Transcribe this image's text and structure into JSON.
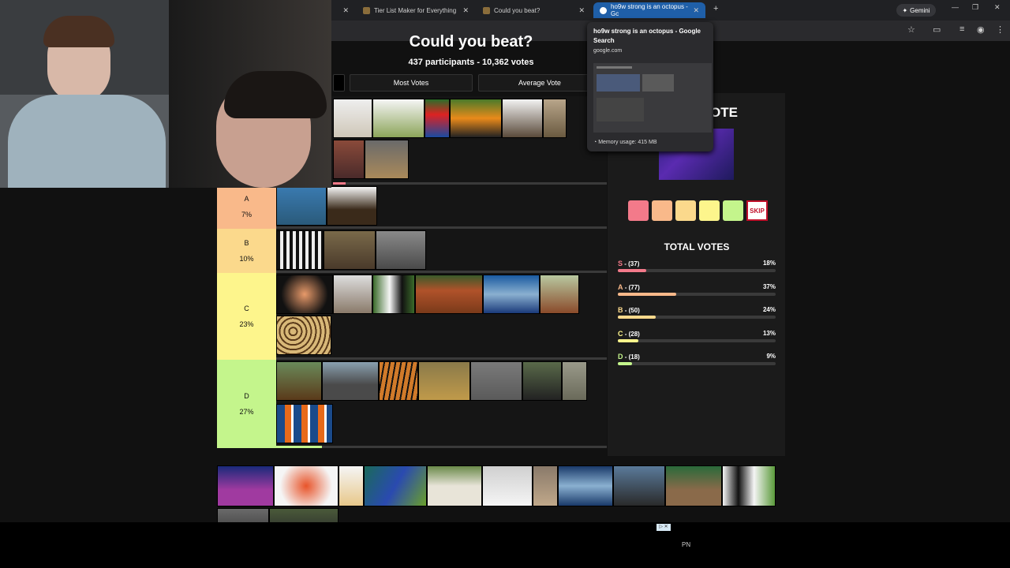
{
  "tabs": [
    {
      "title": "Tier List Maker for Everything",
      "active": false
    },
    {
      "title": "Could you beat?",
      "active": false
    },
    {
      "title": "ho9w strong is an octopus - Gc",
      "active": true
    }
  ],
  "toolbar": {
    "gemini_label": "Gemini"
  },
  "hover_card": {
    "title": "ho9w strong is an octopus - Google Search",
    "url": "google.com",
    "memory": "Memory usage: 415 MB"
  },
  "page": {
    "title": "Could you beat?",
    "subtitle": "437 participants - 10,362 votes",
    "toggle_most": "Most Votes",
    "toggle_average": "Average Vote"
  },
  "tiers": [
    {
      "letter": "A",
      "pct": "7%",
      "color": "#f9b98a"
    },
    {
      "letter": "B",
      "pct": "10%",
      "color": "#fbd98c"
    },
    {
      "letter": "C",
      "pct": "23%",
      "color": "#fdf58c"
    },
    {
      "letter": "D",
      "pct": "27%",
      "color": "#c4f58c"
    }
  ],
  "vote_panel": {
    "title": "OTE",
    "skip_label": "SKIP",
    "total_title": "TOTAL VOTES",
    "buttons": [
      "#f37a8a",
      "#f9b98a",
      "#fbd98c",
      "#fdf58c",
      "#c4f58c"
    ],
    "rows": [
      {
        "letter": "S",
        "count": " - (37)",
        "pct": "18%",
        "color": "#f37a8a",
        "value": 0.18
      },
      {
        "letter": "A",
        "count": " - (77)",
        "pct": "37%",
        "color": "#f9b98a",
        "value": 0.37
      },
      {
        "letter": "B",
        "count": " - (50)",
        "pct": "24%",
        "color": "#fbd98c",
        "value": 0.24
      },
      {
        "letter": "C",
        "count": " - (28)",
        "pct": "13%",
        "color": "#fdf58c",
        "value": 0.13
      },
      {
        "letter": "D",
        "count": " - (18)",
        "pct": "9%",
        "color": "#c4f58c",
        "value": 0.09
      }
    ]
  },
  "footer": {
    "pn": "PN",
    "ad": "▷ ✕"
  }
}
